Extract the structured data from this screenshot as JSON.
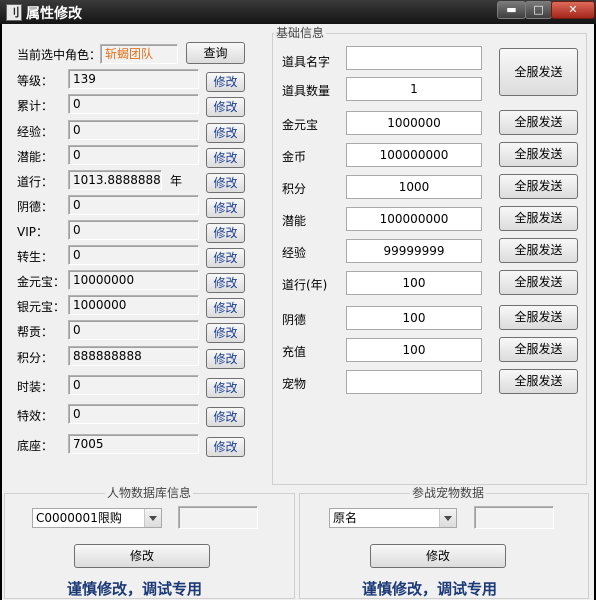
{
  "window": {
    "title": "属性修改",
    "app_icon": "刂",
    "minimize_glyph": "▬",
    "maximize_glyph": "□",
    "close_glyph": "✕"
  },
  "left": {
    "role_label": "当前选中角色：",
    "role_value": "斩蝎团队",
    "query_button": "查询",
    "modify_label": "修改",
    "rows": [
      {
        "label": "等级：",
        "value": "139"
      },
      {
        "label": "累计：",
        "value": "0"
      },
      {
        "label": "经验：",
        "value": "0"
      },
      {
        "label": "潜能：",
        "value": "0"
      },
      {
        "label": "道行：",
        "value": "1013.888888889",
        "unit": "年"
      },
      {
        "label": "阴德：",
        "value": "0"
      },
      {
        "label": "VIP：",
        "value": "0"
      },
      {
        "label": "转生：",
        "value": "0"
      },
      {
        "label": "金元宝：",
        "value": "10000000"
      },
      {
        "label": "银元宝：",
        "value": "1000000"
      },
      {
        "label": "帮贡：",
        "value": "0"
      },
      {
        "label": "积分：",
        "value": "888888888"
      },
      {
        "label": "时装：",
        "value": "0"
      },
      {
        "label": "特效：",
        "value": "0"
      },
      {
        "label": "底座：",
        "value": "7005"
      }
    ]
  },
  "basic_info": {
    "title": "基础信息",
    "send_all_label": "全服发送",
    "item_name_label": "道具名字",
    "item_name_value": "",
    "item_count_label": "道具数量",
    "item_count_value": "1",
    "rows": [
      {
        "label": "金元宝",
        "value": "1000000"
      },
      {
        "label": "金币",
        "value": "100000000"
      },
      {
        "label": "积分",
        "value": "1000"
      },
      {
        "label": "潜能",
        "value": "100000000"
      },
      {
        "label": "经验",
        "value": "99999999"
      },
      {
        "label": "道行(年)",
        "value": "100"
      },
      {
        "label": "阴德",
        "value": "100"
      },
      {
        "label": "充值",
        "value": "100"
      },
      {
        "label": "宠物",
        "value": ""
      }
    ]
  },
  "char_db": {
    "title": "人物数据库信息",
    "combo_value": "C0000001限购",
    "text_value": "",
    "modify_button": "修改",
    "warning": "谨慎修改，调试专用"
  },
  "pet_db": {
    "title": "参战宠物数据",
    "combo_value": "原名",
    "text_value": "",
    "modify_button": "修改",
    "warning": "谨慎修改，调试专用"
  }
}
